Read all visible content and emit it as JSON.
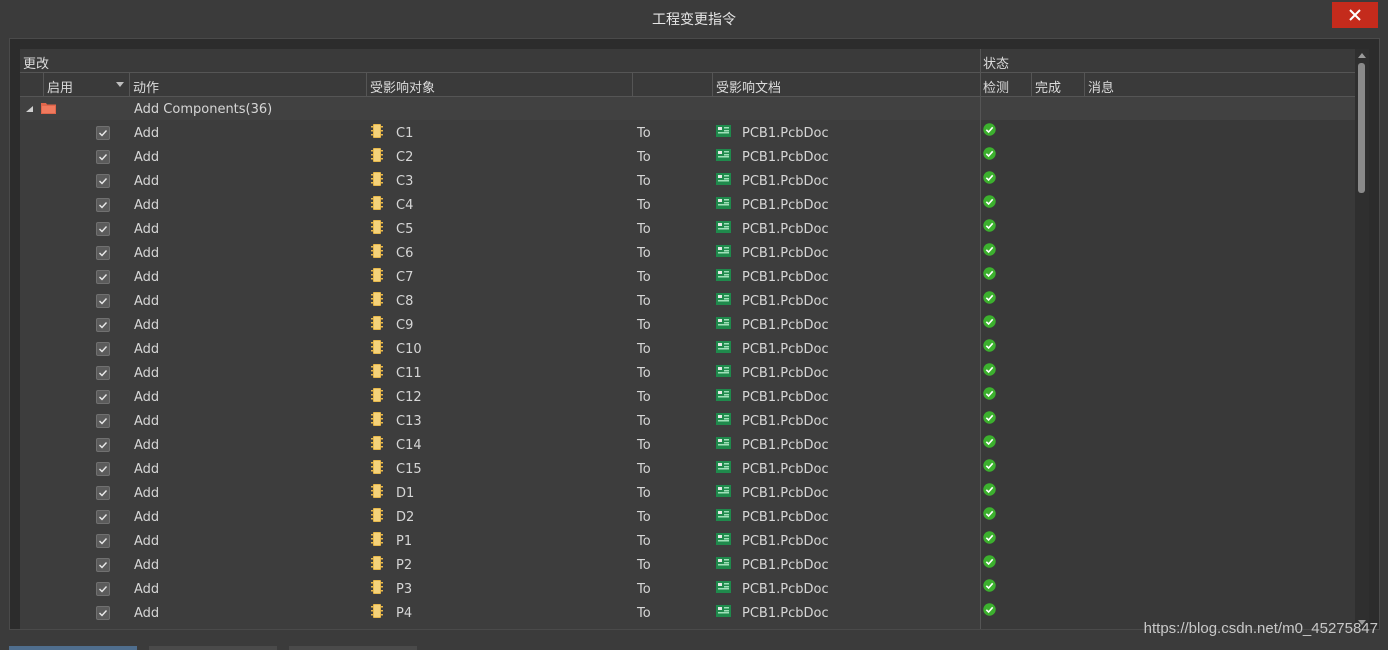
{
  "window": {
    "title": "工程变更指令"
  },
  "columns": {
    "group_changes": "更改",
    "group_status": "状态",
    "enable": "启用",
    "action": "动作",
    "affected_object": "受影响对象",
    "affected_doc": "受影响文档",
    "check": "检测",
    "done": "完成",
    "message": "消息"
  },
  "group": {
    "label": "Add Components(36)"
  },
  "rows": [
    {
      "action": "Add",
      "object": "C1",
      "to": "To",
      "doc": "PCB1.PcbDoc"
    },
    {
      "action": "Add",
      "object": "C2",
      "to": "To",
      "doc": "PCB1.PcbDoc"
    },
    {
      "action": "Add",
      "object": "C3",
      "to": "To",
      "doc": "PCB1.PcbDoc"
    },
    {
      "action": "Add",
      "object": "C4",
      "to": "To",
      "doc": "PCB1.PcbDoc"
    },
    {
      "action": "Add",
      "object": "C5",
      "to": "To",
      "doc": "PCB1.PcbDoc"
    },
    {
      "action": "Add",
      "object": "C6",
      "to": "To",
      "doc": "PCB1.PcbDoc"
    },
    {
      "action": "Add",
      "object": "C7",
      "to": "To",
      "doc": "PCB1.PcbDoc"
    },
    {
      "action": "Add",
      "object": "C8",
      "to": "To",
      "doc": "PCB1.PcbDoc"
    },
    {
      "action": "Add",
      "object": "C9",
      "to": "To",
      "doc": "PCB1.PcbDoc"
    },
    {
      "action": "Add",
      "object": "C10",
      "to": "To",
      "doc": "PCB1.PcbDoc"
    },
    {
      "action": "Add",
      "object": "C11",
      "to": "To",
      "doc": "PCB1.PcbDoc"
    },
    {
      "action": "Add",
      "object": "C12",
      "to": "To",
      "doc": "PCB1.PcbDoc"
    },
    {
      "action": "Add",
      "object": "C13",
      "to": "To",
      "doc": "PCB1.PcbDoc"
    },
    {
      "action": "Add",
      "object": "C14",
      "to": "To",
      "doc": "PCB1.PcbDoc"
    },
    {
      "action": "Add",
      "object": "C15",
      "to": "To",
      "doc": "PCB1.PcbDoc"
    },
    {
      "action": "Add",
      "object": "D1",
      "to": "To",
      "doc": "PCB1.PcbDoc"
    },
    {
      "action": "Add",
      "object": "D2",
      "to": "To",
      "doc": "PCB1.PcbDoc"
    },
    {
      "action": "Add",
      "object": "P1",
      "to": "To",
      "doc": "PCB1.PcbDoc"
    },
    {
      "action": "Add",
      "object": "P2",
      "to": "To",
      "doc": "PCB1.PcbDoc"
    },
    {
      "action": "Add",
      "object": "P3",
      "to": "To",
      "doc": "PCB1.PcbDoc"
    },
    {
      "action": "Add",
      "object": "P4",
      "to": "To",
      "doc": "PCB1.PcbDoc"
    }
  ],
  "watermark": "https://blog.csdn.net/m0_45275847",
  "colors": {
    "check_ok": "#3cb02e",
    "close_button": "#c42b1c",
    "folder_icon": "#e0664b"
  }
}
